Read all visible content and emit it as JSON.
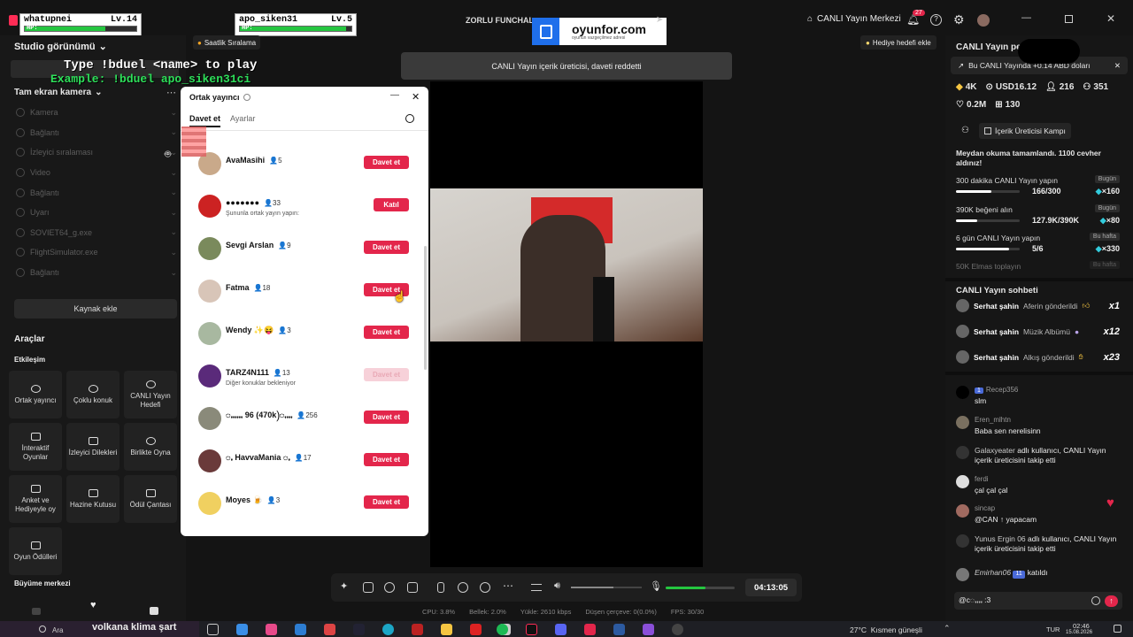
{
  "overlay": {
    "user1": {
      "name": "whatupnei",
      "level": "Lv.14",
      "hp_label": "HP:",
      "hp": 0.72
    },
    "user2": {
      "name": "apo_siken31",
      "level": "Lv.5",
      "hp_label": "HP:",
      "hp": 0.95
    },
    "type_cmd": "Type !bduel <name> to play",
    "example_cmd": "Example: !bduel apo_siken31ci",
    "hourly_ranking": "Saatlik Sıralama",
    "sponsor_brand": "oyunfor.com",
    "sponsor_tagline": "oyunun vazgeçilmez adresi"
  },
  "header": {
    "stream_title": "ZORLU FUNCHAL",
    "live_center": "CANLI Yayın Merkezi",
    "notif_count": "27",
    "gift_goal": "Hediye hedefi ekle"
  },
  "toast": "CANLI Yayın içerik üreticisi, daveti reddetti",
  "left": {
    "studio_view": "Studio görünümü",
    "camera_mode": "Tam ekran kamera",
    "sources": [
      "Kamera",
      "Bağlantı",
      "İzleyici sıralaması",
      "Video",
      "Bağlantı",
      "Uyarı",
      "SOVIET64_g.exe",
      "FlightSimulator.exe",
      "Bağlantı"
    ],
    "add_source": "Kaynak ekle",
    "tools_title": "Araçlar",
    "engagement": "Etkileşim",
    "tools": [
      "Ortak yayıncı",
      "Çoklu konuk",
      "CANLI Yayın Hedefi",
      "İnteraktif Oyunlar",
      "İzleyici Dilekleri",
      "Birlikte Oyna",
      "Anket ve Hediyeyle oy",
      "Hazine Kutusu",
      "Ödül Çantası",
      "Oyun Ödülleri"
    ],
    "growth": "Büyüme merkezi"
  },
  "modal": {
    "title": "Ortak yayıncı",
    "tab_invite": "Davet et",
    "tab_settings": "Ayarlar",
    "rows": [
      {
        "name": "AvaMasihi",
        "count": "5",
        "button": "Davet et",
        "sub": ""
      },
      {
        "name": "●●●●●●●",
        "count": "33",
        "button": "Katıl",
        "sub": "Şununla ortak yayın yapın:"
      },
      {
        "name": "Sevgi Arslan",
        "count": "9",
        "button": "Davet et",
        "sub": ""
      },
      {
        "name": "Fatma",
        "count": "18",
        "button": "Davet et",
        "sub": ""
      },
      {
        "name": "Wendy ✨😝",
        "count": "3",
        "button": "Davet et",
        "sub": ""
      },
      {
        "name": "TARZ4N111",
        "count": "13",
        "button": "Davet et",
        "sub": "Diğer konuklar bekleniyor"
      },
      {
        "name": "ꩻꩻꩻꩻꩻꩻ 96 (470k)ꩻꩻꩻꩻ",
        "count": "256",
        "button": "Davet et",
        "sub": ""
      },
      {
        "name": "ꩻ HavvaMania ꩻ",
        "count": "17",
        "button": "Davet et",
        "sub": ""
      },
      {
        "name": "Moyes 🍺",
        "count": "3",
        "button": "Davet et",
        "sub": ""
      }
    ]
  },
  "right": {
    "live_label": "CANLI Yayın per",
    "earn_banner": "Bu CANLI Yayında +0.14 ABD doları",
    "stats": {
      "viewers": "4K",
      "usd": "USD16.12",
      "followers": "216",
      "diamonds": "351",
      "likes": "0.2M",
      "gifts": "130"
    },
    "creator_camp": "İçerik Üreticisi Kampı",
    "reading_done": "Meydan okuma tamamlandı. 1100 cevher aldınız!",
    "tasks": [
      {
        "title": "300 dakika CANLI Yayın yapın",
        "badge": "Bugün",
        "progress": "166/300",
        "reward": "×160",
        "frac": 0.55
      },
      {
        "title": "390K beğeni alın",
        "badge": "Bugün",
        "progress": "127.9K/390K",
        "reward": "×80",
        "frac": 0.33
      },
      {
        "title": "6 gün CANLI Yayın yapın",
        "badge": "Bu hafta",
        "progress": "5/6",
        "reward": "×330",
        "frac": 0.83
      },
      {
        "title": "50K Elmas toplayın",
        "badge": "Bu hafta",
        "progress": "",
        "reward": "",
        "frac": 0
      }
    ],
    "chat_title": "CANLI Yayın sohbeti",
    "gifts": [
      {
        "user": "Serhat şahin",
        "gift": "Aferin gönderildi",
        "mult": "x1"
      },
      {
        "user": "Serhat şahin",
        "gift": "Müzik Albümü",
        "mult": "x12"
      },
      {
        "user": "Serhat şahin",
        "gift": "Alkış gönderildi",
        "mult": "x23"
      }
    ],
    "messages": [
      {
        "level": "1",
        "user": "Recep356",
        "text": "slm"
      },
      {
        "level": "",
        "user": "Eren_mlhtn",
        "text": "Baba sen nerelisinn"
      },
      {
        "level": "",
        "user": "Galaxyeater",
        "text": "adlı kullanıcı, CANLI Yayın içerik üreticisini takip etti"
      },
      {
        "level": "",
        "user": "ferdi",
        "text": "çal çal çal"
      },
      {
        "level": "",
        "user": "sincap",
        "text": "@CAN ↑ yapacam"
      },
      {
        "level": "",
        "user": "Yunus Ergin 06",
        "text": "adlı kullanıcı, CANLI Yayın içerik üreticisini takip etti"
      },
      {
        "level": "11",
        "user": "Emirhan06",
        "text": "katıldı"
      }
    ],
    "input_value": "@cꩻꩻꩻꩻ :3"
  },
  "toolbar": {
    "timer": "04:13:05",
    "volume": 0.6,
    "stats": {
      "cpu": "CPU: 3.8%",
      "mem": "Bellek: 2.0%",
      "upload": "Yükle: 2610 kbps",
      "dropped": "Düşen çerçeve: 0(0.0%)",
      "fps": "FPS: 30/30"
    }
  },
  "taskbar": {
    "search": "Ara",
    "ticker": "volkana klima şart",
    "weather": "27°C  Kısmen güneşli",
    "lang": "TUR",
    "time": "02:46",
    "date": "15.08.2026"
  },
  "colors": {
    "accent": "#e3264b",
    "panel": "#181818",
    "bg": "#141414"
  }
}
